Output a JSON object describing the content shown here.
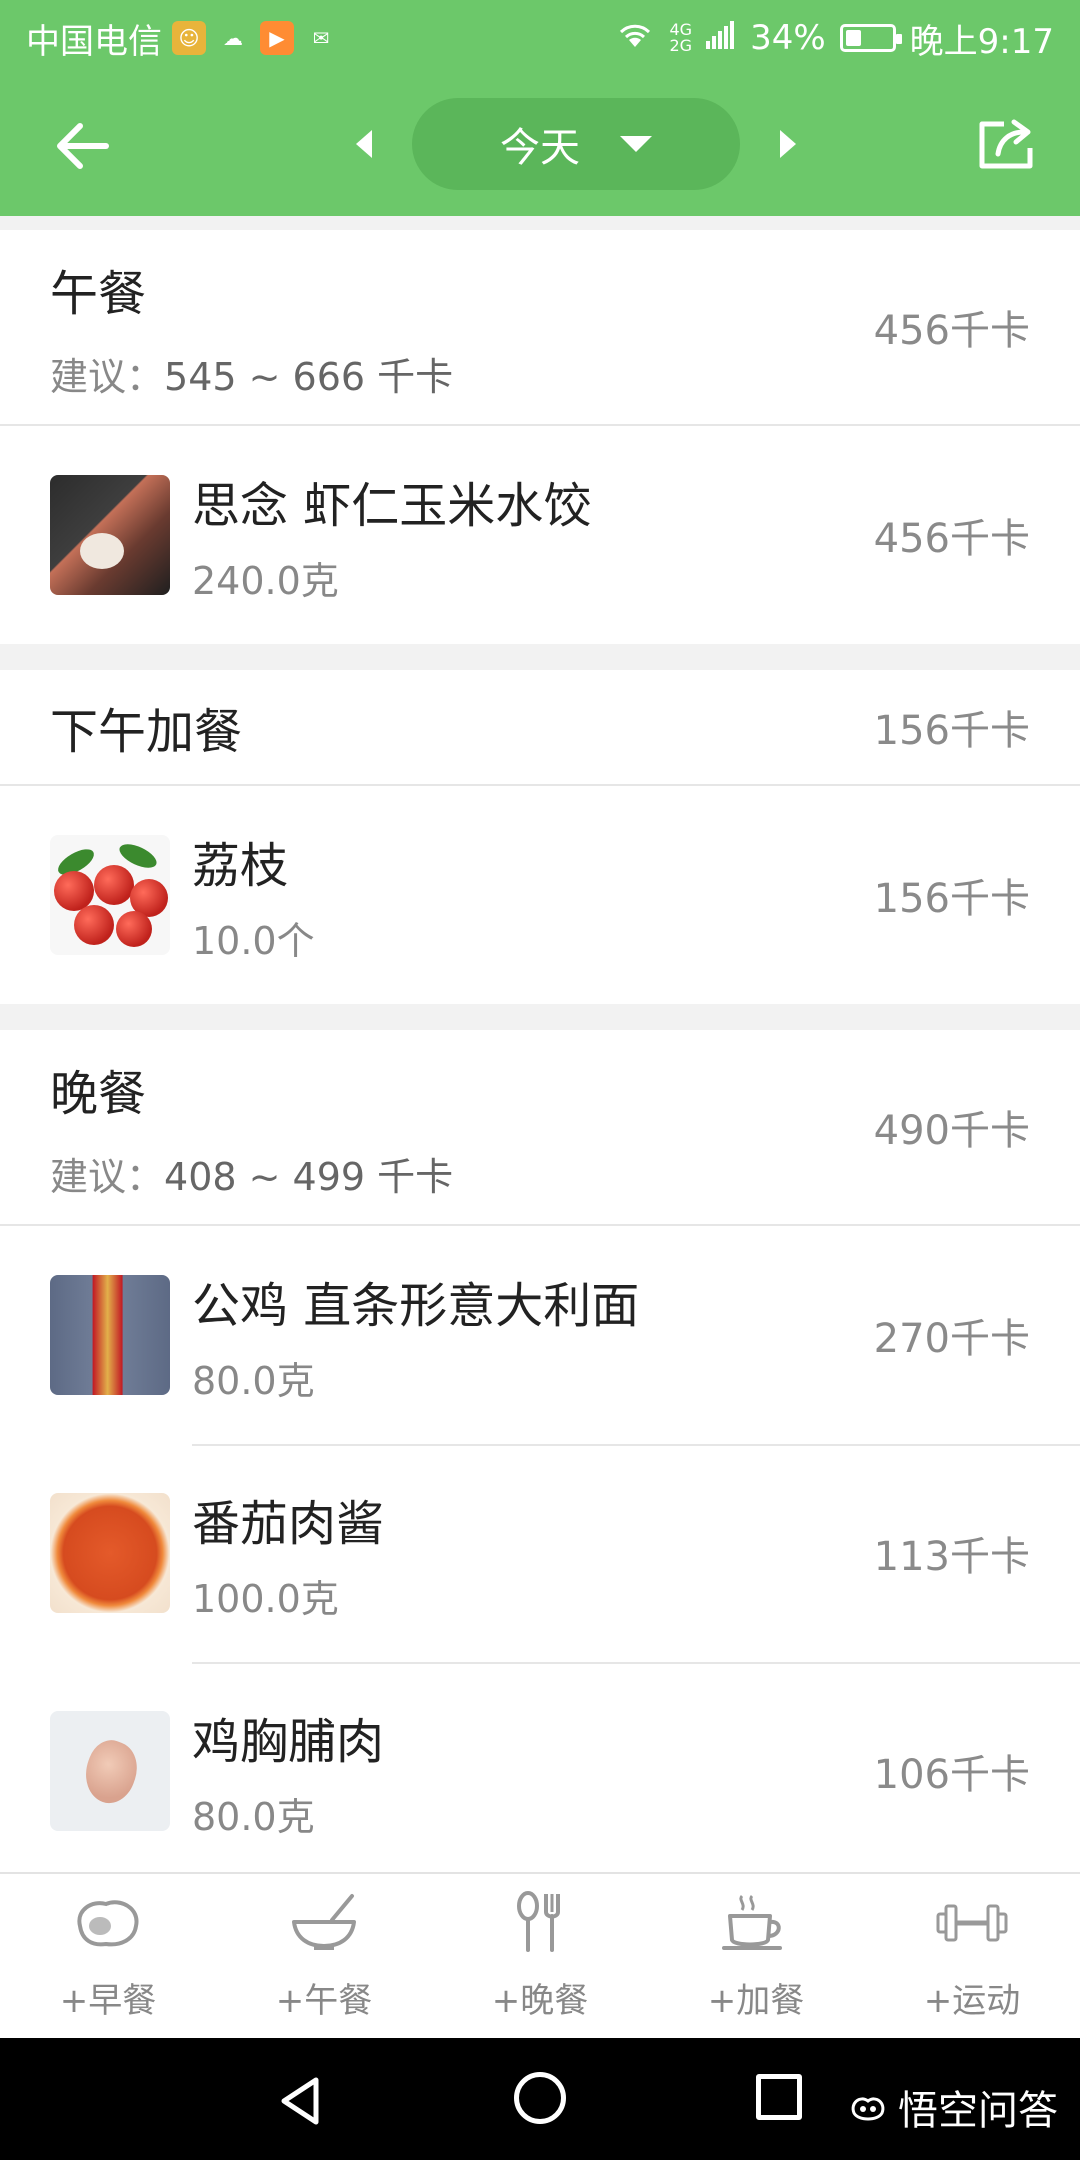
{
  "status_bar": {
    "carrier": "中国电信",
    "battery_percent": "34%",
    "battery_level": 0.34,
    "time": "晚上9:17",
    "network": "4G",
    "network2": "2G"
  },
  "nav": {
    "date_label": "今天"
  },
  "sections": {
    "lunch": {
      "title": "午餐",
      "hint_prefix": "建议：",
      "hint_value": "545 ~ 666 千卡",
      "kcal": "456千卡",
      "items": [
        {
          "name": "思念 虾仁玉米水饺",
          "amount": "240.0克",
          "kcal": "456千卡"
        }
      ]
    },
    "afternoon_snack": {
      "title": "下午加餐",
      "kcal": "156千卡",
      "items": [
        {
          "name": "荔枝",
          "amount": "10.0个",
          "kcal": "156千卡"
        }
      ]
    },
    "dinner": {
      "title": "晚餐",
      "hint_prefix": "建议：",
      "hint_value": "408 ~ 499 千卡",
      "kcal": "490千卡",
      "items": [
        {
          "name": "公鸡 直条形意大利面",
          "amount": "80.0克",
          "kcal": "270千卡"
        },
        {
          "name": "番茄肉酱",
          "amount": "100.0克",
          "kcal": "113千卡"
        },
        {
          "name": "鸡胸脯肉",
          "amount": "80.0克",
          "kcal": "106千卡"
        }
      ]
    }
  },
  "actions": [
    {
      "label": "+早餐",
      "icon": "egg-icon"
    },
    {
      "label": "+午餐",
      "icon": "bowl-icon"
    },
    {
      "label": "+晚餐",
      "icon": "spoon-fork-icon"
    },
    {
      "label": "+加餐",
      "icon": "coffee-cup-icon"
    },
    {
      "label": "+运动",
      "icon": "dumbbell-icon"
    }
  ],
  "watermark": "悟空问答",
  "colors": {
    "brand_green": "#6cc86a",
    "pill_green": "#5bb65a"
  }
}
